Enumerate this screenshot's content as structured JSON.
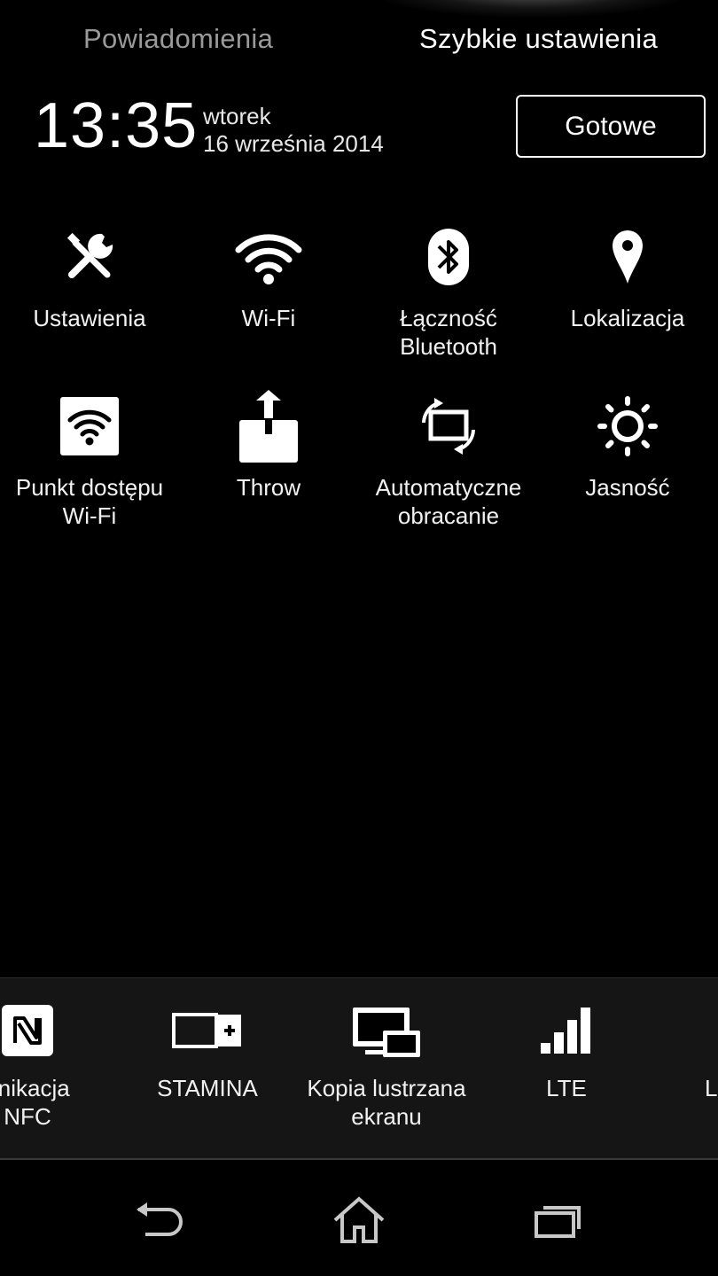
{
  "tabs": {
    "notifications": "Powiadomienia",
    "quick_settings": "Szybkie ustawienia"
  },
  "header": {
    "time": "13:35",
    "weekday": "wtorek",
    "date": "16 września 2014",
    "done_label": "Gotowe"
  },
  "tiles": [
    {
      "label_line1": "Ustawienia",
      "label_line2": "",
      "icon": "settings-tools-icon"
    },
    {
      "label_line1": "Wi-Fi",
      "label_line2": "",
      "icon": "wifi-icon"
    },
    {
      "label_line1": "Łączność",
      "label_line2": "Bluetooth",
      "icon": "bluetooth-icon"
    },
    {
      "label_line1": "Lokalizacja",
      "label_line2": "",
      "icon": "location-pin-icon"
    },
    {
      "label_line1": "Punkt dostępu",
      "label_line2": "Wi-Fi",
      "icon": "wifi-hotspot-icon"
    },
    {
      "label_line1": "Throw",
      "label_line2": "",
      "icon": "throw-icon"
    },
    {
      "label_line1": "Automatyczne",
      "label_line2": "obracanie",
      "icon": "auto-rotate-icon"
    },
    {
      "label_line1": "Jasność",
      "label_line2": "",
      "icon": "brightness-icon"
    }
  ],
  "bottom_tiles": [
    {
      "label_line1": "unikacja",
      "label_line2": "NFC",
      "icon": "nfc-icon"
    },
    {
      "label_line1": "STAMINA",
      "label_line2": "",
      "icon": "stamina-battery-icon"
    },
    {
      "label_line1": "Kopia lustrzana",
      "label_line2": "ekranu",
      "icon": "screen-mirroring-icon"
    },
    {
      "label_line1": "LTE",
      "label_line2": "",
      "icon": "signal-bars-icon"
    },
    {
      "label_line1": "L",
      "label_line2": "",
      "icon": ""
    }
  ],
  "navbar": {
    "back": "back-icon",
    "home": "home-icon",
    "recents": "recents-icon"
  }
}
